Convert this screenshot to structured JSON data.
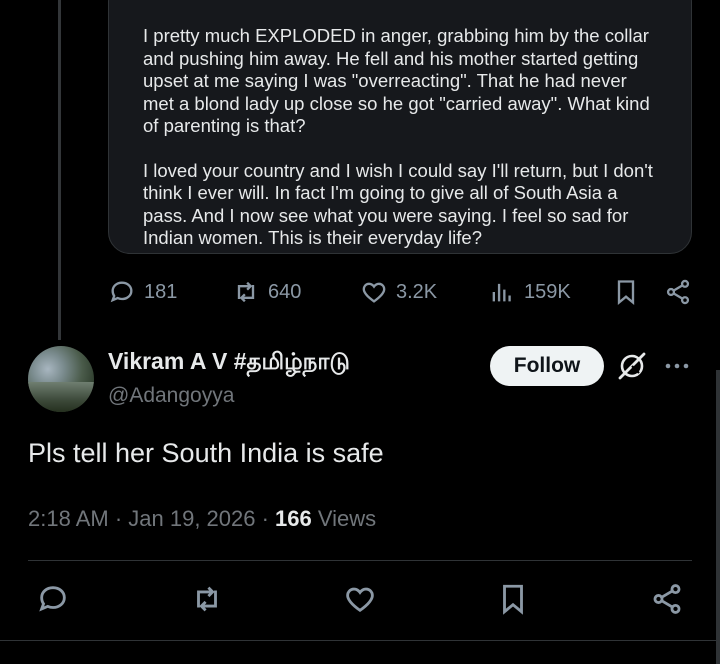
{
  "quoted": {
    "paragraph1": "I pretty much EXPLODED in anger, grabbing him by the collar and pushing him away. He fell and his mother started getting upset at me saying I was \"overreacting\". That he had never met a blond lady up close so he got \"carried away\". What kind of parenting is that?",
    "paragraph2": "I loved your country and I wish I could say I'll return, but I don't think I ever will. In fact I'm going to give all of South Asia a pass. And I now see what you were saying. I feel so sad for Indian women. This is their everyday life?"
  },
  "parent_actions": {
    "replies": "181",
    "reposts": "640",
    "likes": "3.2K",
    "views": "159K"
  },
  "reply": {
    "name": "Vikram A V #தமிழ்நாடு",
    "handle": "@Adangoyya",
    "follow_label": "Follow",
    "text": "Pls tell her South India is safe",
    "time": "2:18 AM · Jan 19, 2026 · ",
    "views_count": "166",
    "views_label": " Views"
  },
  "icons": {
    "reply": "speech-bubble-icon",
    "repost": "repost-icon",
    "like": "heart-icon",
    "views": "bar-chart-icon",
    "bookmark": "bookmark-icon",
    "share": "share-icon",
    "grok": "grok-icon",
    "more": "more-icon"
  }
}
